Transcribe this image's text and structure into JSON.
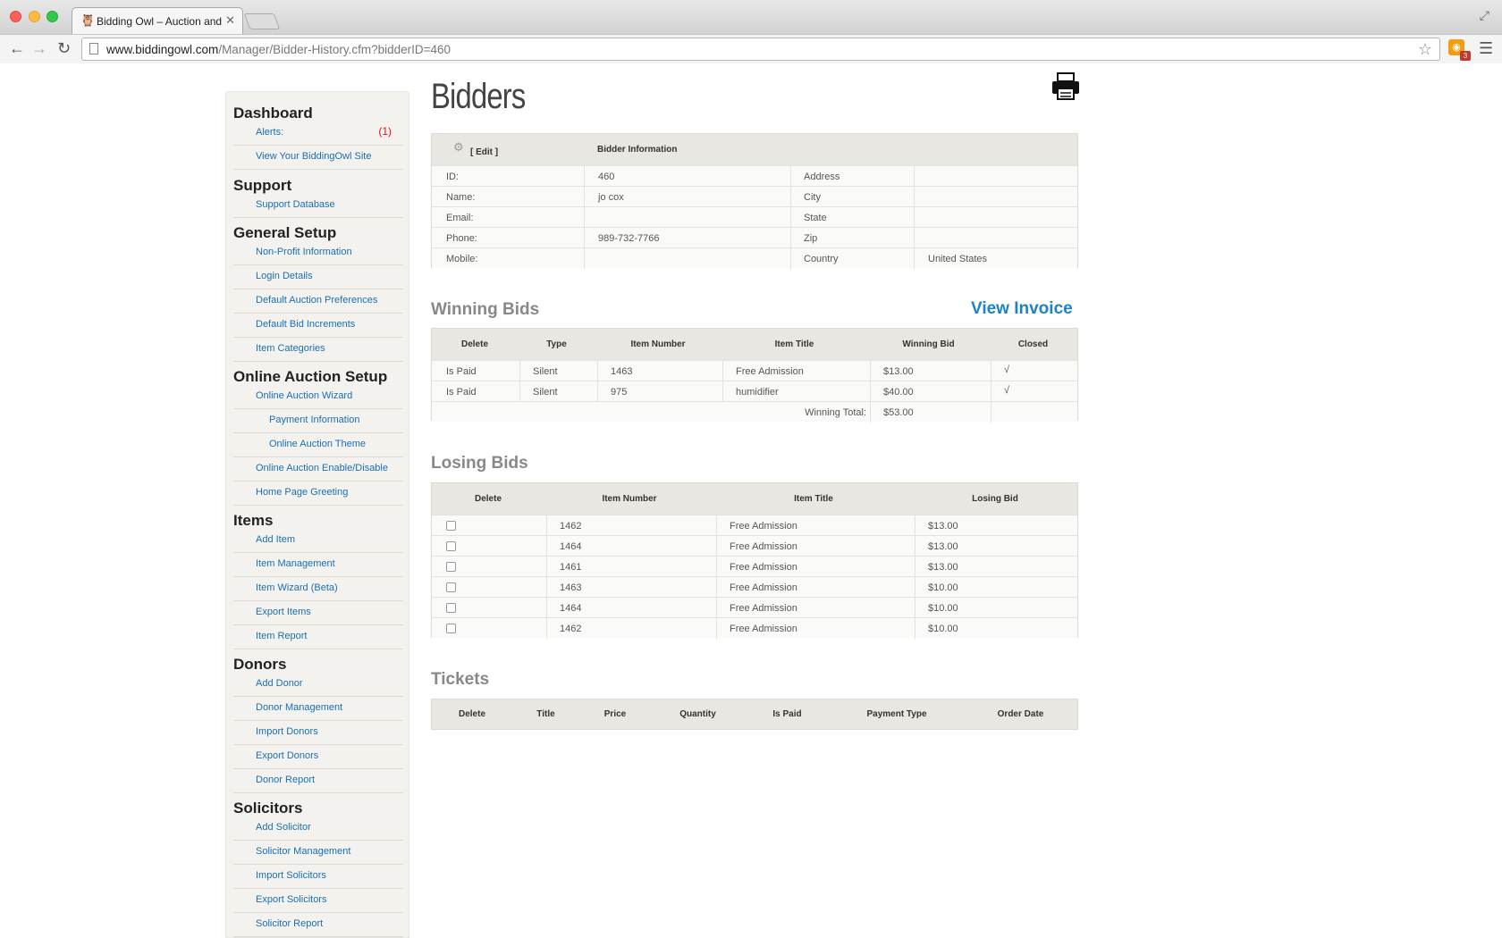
{
  "browser": {
    "tab_title": "Bidding Owl – Auction and",
    "url_host": "www.biddingowl.com",
    "url_path": "/Manager/Bidder-History.cfm?bidderID=460",
    "rss_badge": "3"
  },
  "sidebar": {
    "dashboard": "Dashboard",
    "alerts_label": "Alerts:",
    "alerts_count": "(1)",
    "view_site": "View Your BiddingOwl Site",
    "support": "Support",
    "support_db": "Support Database",
    "general_setup": "General Setup",
    "nonprofit": "Non-Profit Information",
    "login": "Login Details",
    "default_prefs": "Default Auction Preferences",
    "default_bid": "Default Bid Increments",
    "item_categories": "Item Categories",
    "online_setup": "Online Auction Setup",
    "online_wizard": "Online Auction Wizard",
    "payment_info": "Payment Information",
    "online_theme": "Online Auction Theme",
    "online_enable": "Online Auction Enable/Disable",
    "home_greeting": "Home Page Greeting",
    "items": "Items",
    "add_item": "Add Item",
    "item_mgmt": "Item Management",
    "item_wizard": "Item Wizard (Beta)",
    "export_items": "Export Items",
    "item_report": "Item Report",
    "donors": "Donors",
    "add_donor": "Add Donor",
    "donor_mgmt": "Donor Management",
    "import_donors": "Import Donors",
    "export_donors": "Export Donors",
    "donor_report": "Donor Report",
    "solicitors": "Solicitors",
    "add_solicitor": "Add Solicitor",
    "solicitor_mgmt": "Solicitor Management",
    "import_solicitors": "Import Solicitors",
    "export_solicitors": "Export Solicitors",
    "solicitor_report": "Solicitor Report"
  },
  "page": {
    "title": "Bidders"
  },
  "bidder": {
    "edit": "[ Edit ]",
    "header": "Bidder Information",
    "id_label": "ID:",
    "id_value": "460",
    "name_label": "Name:",
    "name_value": "jo cox",
    "email_label": "Email:",
    "email_value": "",
    "phone_label": "Phone:",
    "phone_value": "989-732-7766",
    "mobile_label": "Mobile:",
    "mobile_value": "",
    "address_label": "Address",
    "address_value": "",
    "city_label": "City",
    "city_value": "",
    "state_label": "State",
    "state_value": "",
    "zip_label": "Zip",
    "zip_value": "",
    "country_label": "Country",
    "country_value": "United States"
  },
  "winning": {
    "title": "Winning Bids",
    "view_invoice": "View Invoice",
    "headers": [
      "Delete",
      "Type",
      "Item Number",
      "Item Title",
      "Winning Bid",
      "Closed"
    ],
    "rows": [
      {
        "delete": "Is Paid",
        "type": "Silent",
        "item_number": "1463",
        "item_title": "Free Admission",
        "bid": "$13.00",
        "closed": "√"
      },
      {
        "delete": "Is Paid",
        "type": "Silent",
        "item_number": "975",
        "item_title": "humidifier",
        "bid": "$40.00",
        "closed": "√"
      }
    ],
    "total_label": "Winning Total:",
    "total_value": "$53.00"
  },
  "losing": {
    "title": "Losing Bids",
    "headers": [
      "Delete",
      "Item Number",
      "Item Title",
      "Losing Bid"
    ],
    "rows": [
      {
        "item_number": "1462",
        "item_title": "Free Admission",
        "bid": "$13.00"
      },
      {
        "item_number": "1464",
        "item_title": "Free Admission",
        "bid": "$13.00"
      },
      {
        "item_number": "1461",
        "item_title": "Free Admission",
        "bid": "$13.00"
      },
      {
        "item_number": "1463",
        "item_title": "Free Admission",
        "bid": "$10.00"
      },
      {
        "item_number": "1464",
        "item_title": "Free Admission",
        "bid": "$10.00"
      },
      {
        "item_number": "1462",
        "item_title": "Free Admission",
        "bid": "$10.00"
      }
    ]
  },
  "tickets": {
    "title": "Tickets",
    "headers": [
      "Delete",
      "Title",
      "Price",
      "Quantity",
      "Is Paid",
      "Payment Type",
      "Order Date"
    ]
  }
}
